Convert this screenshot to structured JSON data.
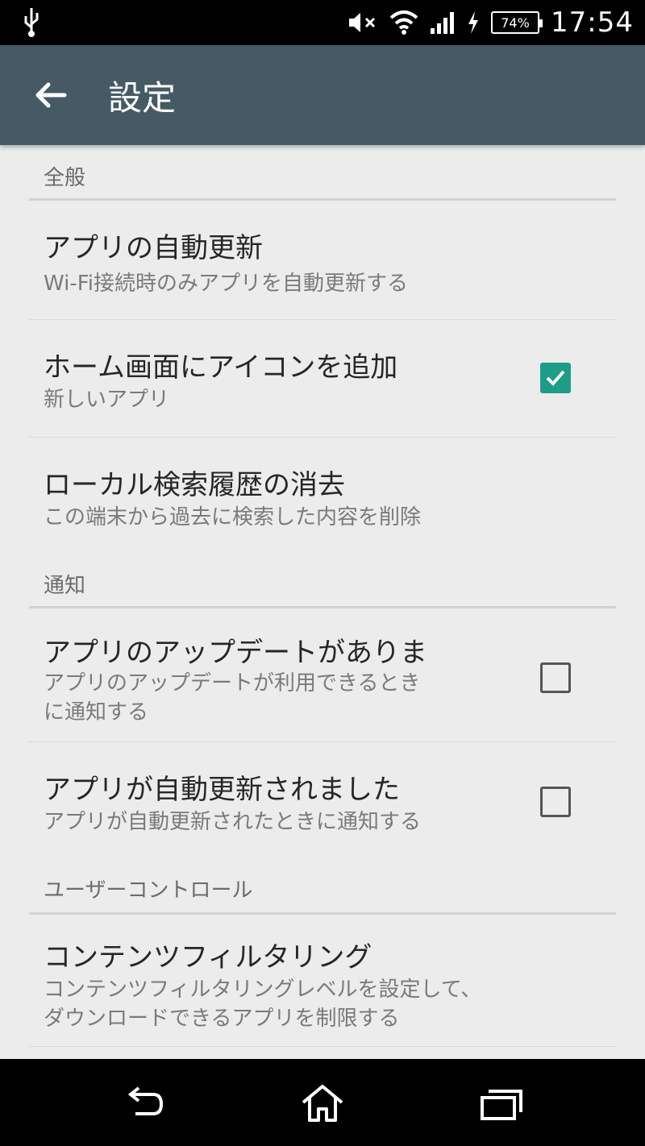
{
  "status_bar": {
    "battery_percent": "74%",
    "time": "17:54",
    "icons": [
      "usb-icon",
      "mute-icon",
      "wifi-icon",
      "signal-icon",
      "charging-icon",
      "battery-icon"
    ]
  },
  "app_bar": {
    "title": "設定",
    "back_icon": "arrow-left-icon"
  },
  "sections": {
    "general": {
      "header": "全般",
      "items": [
        {
          "title": "アプリの自動更新",
          "subtitle": "Wi-Fi接続時のみアプリを自動更新する"
        },
        {
          "title": "ホーム画面にアイコンを追加",
          "subtitle": "新しいアプリ",
          "checked": true
        },
        {
          "title": "ローカル検索履歴の消去",
          "subtitle": "この端末から過去に検索した内容を削除"
        }
      ]
    },
    "notifications": {
      "header": "通知",
      "items": [
        {
          "title": "アプリのアップデートがありま",
          "subtitle_line1": "アプリのアップデートが利用できるとき",
          "subtitle_line2": "に通知する",
          "checked": false
        },
        {
          "title": "アプリが自動更新されました",
          "subtitle": "アプリが自動更新されたときに通知する",
          "checked": false
        }
      ]
    },
    "user_controls": {
      "header": "ユーザーコントロール",
      "items": [
        {
          "title": "コンテンツフィルタリング",
          "subtitle_line1": "コンテンツフィルタリングレベルを設定して、",
          "subtitle_line2": "ダウンロードできるアプリを制限する"
        }
      ]
    }
  },
  "colors": {
    "app_bar": "#455a64",
    "accent": "#1e9c88",
    "background": "#ececec"
  },
  "nav_bar": {
    "icons": [
      "back-nav-icon",
      "home-icon",
      "recents-icon"
    ]
  }
}
